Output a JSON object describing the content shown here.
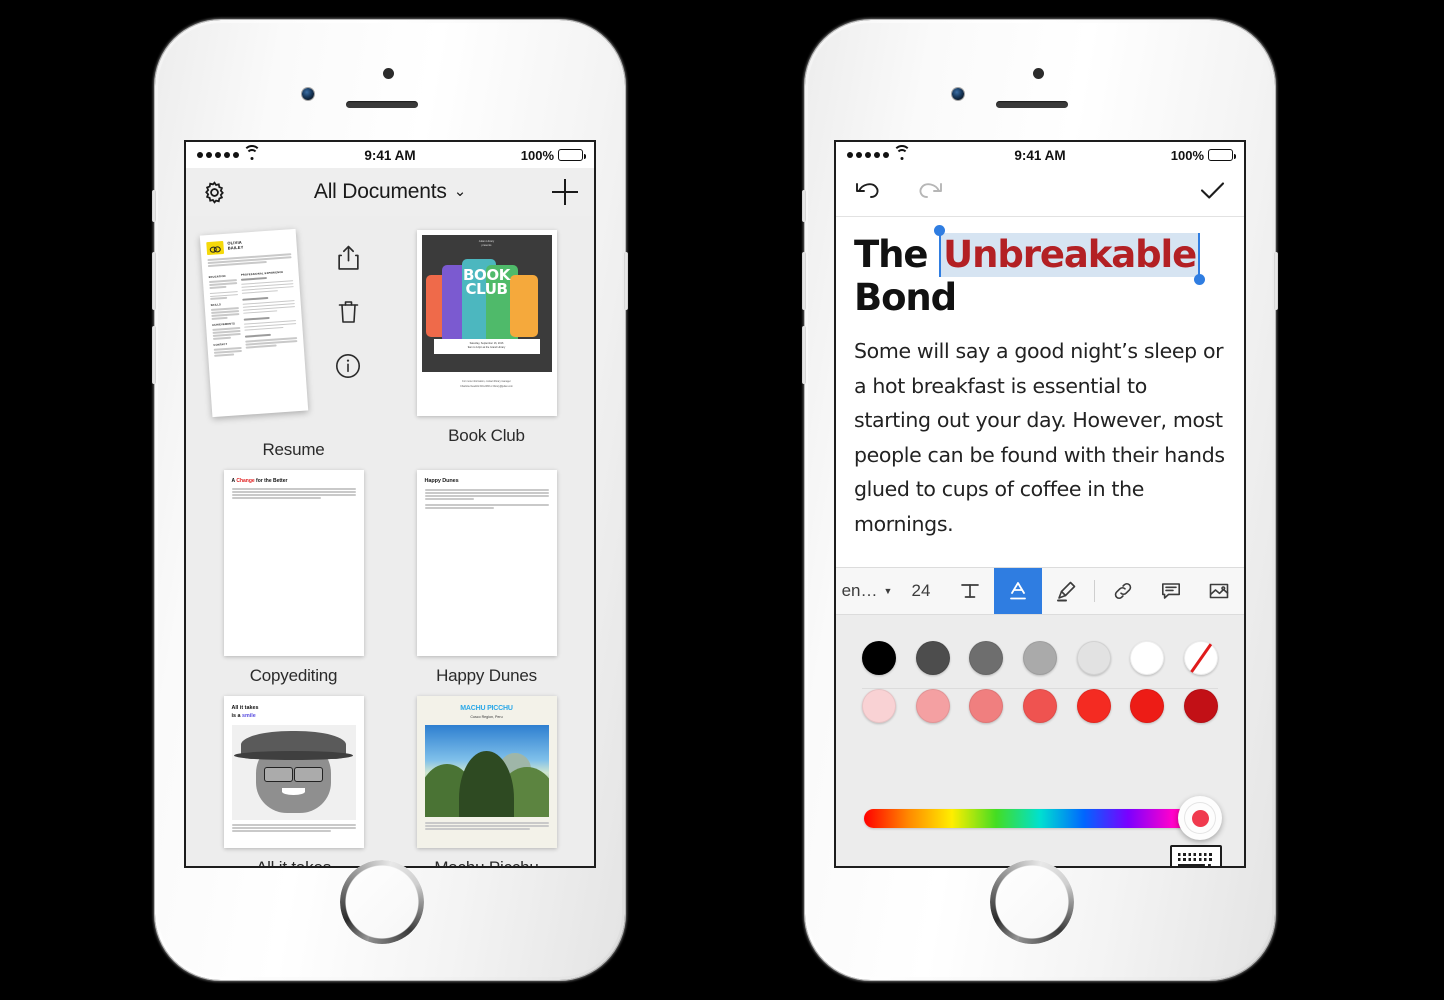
{
  "left_phone": {
    "status_bar": {
      "time": "9:41 AM",
      "battery_percent": "100%",
      "signal_dots": 5
    },
    "nav": {
      "title": "All Documents",
      "chevron": "⌄",
      "settings_icon": "gear-icon",
      "add_icon": "plus-icon"
    },
    "swipe_actions": [
      {
        "name": "share-icon",
        "label": "Share"
      },
      {
        "name": "trash-icon",
        "label": "Delete"
      },
      {
        "name": "info-icon",
        "label": "Info"
      }
    ],
    "documents": [
      {
        "title": "Resume",
        "swiped": true
      },
      {
        "title": "Book Club",
        "swiped": false
      },
      {
        "title": "Copyediting",
        "swiped": false
      },
      {
        "title": "Happy Dunes",
        "swiped": false
      },
      {
        "title": "All it takes",
        "swiped": false
      },
      {
        "title": "Machu Picchu",
        "swiped": false
      }
    ],
    "thumbs": {
      "resume": {
        "name_line1": "OLIVIA",
        "name_line2": "BAILEY",
        "sections": [
          "EDUCATION",
          "SKILLS",
          "ACHIEVEMENTS",
          "CONTACT"
        ],
        "right_heading": "PROFESSIONAL EXPERIENCE"
      },
      "book_club": {
        "presenter": "Julian Library",
        "presents": "presents",
        "title_line1": "BOOK",
        "title_line2": "CLUB",
        "date": "Saturday, September 16, 2016",
        "time_place": "9am to 12pm at the Grand Library",
        "footer1": "For more information, contact library manager",
        "footer2": "Charlotte Newkirk 619-2483 or library@julian.com",
        "card_colors": [
          "#ef6a4a",
          "#7b5ad0",
          "#4cb7bf",
          "#4fba6a",
          "#f5a93c"
        ]
      },
      "copyediting": {
        "heading_pre": "A ",
        "heading_red": "Change",
        "heading_post": " for the Better",
        "body": "Copywriting has become an integral part of marketing communication today. Content put out by your organization is consumed by people across the globe. Most organizations today have an in-house editor or a communications team working on polishing the copy and setting up a unified voice for their brand."
      },
      "happy_dunes": {
        "heading": "Happy Dunes",
        "body1": "As Leo Tolstoy famously said, \"the way to fame goes through palaces, the way to happiness goes through the markets, the way to virtue goes through the deserts\".",
        "body2_pre": "In my social blog series ",
        "body2_bold": "Happy Dunes",
        "body2_post": ", we will discuss life in the desert, their survival, culture and festivals."
      },
      "smile": {
        "line1": "All it takes",
        "line2_pre": "is a ",
        "line2_accent": "smile"
      },
      "machu_picchu": {
        "title": "MACHU PICCHU",
        "subtitle": "Cusco Region, Peru",
        "body": "Machu Picchu was built in the classical Inca style, with polished dry-stone walls. Its three primary structures are the Inti Watana, the Temple of the Sun, and the Room of the Three Windows. Most of the outlying buildings have"
      }
    }
  },
  "right_phone": {
    "status_bar": {
      "time": "9:41 AM",
      "battery_percent": "100%",
      "signal_dots": 5
    },
    "nav": {
      "undo_icon": "undo-icon",
      "redo_icon": "redo-icon",
      "done_icon": "checkmark-icon"
    },
    "document": {
      "title_prefix": "The ",
      "title_selected": "Unbreakable",
      "title_suffix": "Bond",
      "selected_color": "#b32024",
      "selection_highlight": "#d6e4f2",
      "handle_color": "#2f7de1",
      "paragraph": "Some will say a good night’s sleep or a hot breakfast is essential to starting out your day. However, most people can be found with their hands glued to cups of coffee in the mornings."
    },
    "format_bar": {
      "font_name": "en…",
      "font_dropdown_icon": "chevron-down-icon",
      "font_size": "24",
      "items": [
        {
          "name": "text-format-icon",
          "active": false
        },
        {
          "name": "font-color-icon",
          "active": true
        },
        {
          "name": "highlighter-icon",
          "active": false
        },
        {
          "name": "link-icon",
          "active": false
        },
        {
          "name": "comment-icon",
          "active": false
        },
        {
          "name": "insert-image-icon",
          "active": false
        }
      ],
      "active_accent": "#2f7de1"
    },
    "color_panel": {
      "row1": [
        "#000000",
        "#4d4d4d",
        "#6e6e6e",
        "#aaaaaa",
        "#e2e2e2",
        "#ffffff",
        "none"
      ],
      "row2": [
        "#f9d2d4",
        "#f4a0a2",
        "#f07f7f",
        "#ef5350",
        "#f42b22",
        "#ed1c16",
        "#c21016"
      ],
      "slider": {
        "name": "hue-slider",
        "knob_color": "#f03a4e",
        "knob_position_percent": 100
      },
      "keyboard_button": "keyboard-icon"
    }
  }
}
